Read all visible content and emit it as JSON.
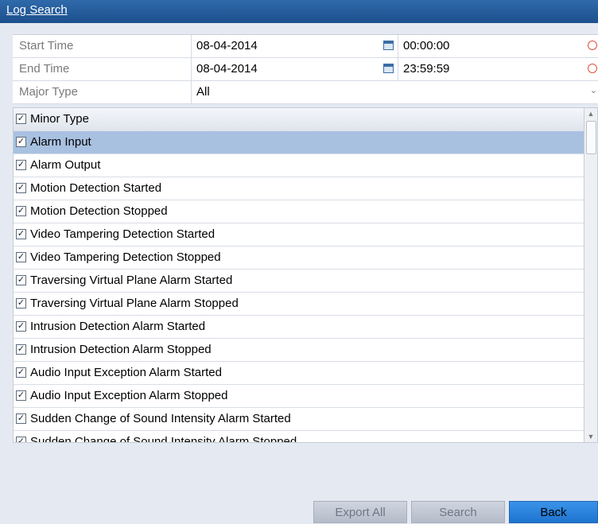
{
  "window": {
    "title": "Log Search"
  },
  "form": {
    "start_time": {
      "label": "Start Time",
      "date": "08-04-2014",
      "time": "00:00:00"
    },
    "end_time": {
      "label": "End Time",
      "date": "08-04-2014",
      "time": "23:59:59"
    },
    "major_type": {
      "label": "Major Type",
      "value": "All"
    }
  },
  "minor_type": {
    "header": "Minor Type",
    "header_checked": true,
    "items": [
      {
        "label": "Alarm Input",
        "checked": true,
        "selected": true
      },
      {
        "label": "Alarm Output",
        "checked": true
      },
      {
        "label": "Motion Detection Started",
        "checked": true
      },
      {
        "label": "Motion Detection Stopped",
        "checked": true
      },
      {
        "label": "Video Tampering Detection Started",
        "checked": true
      },
      {
        "label": "Video Tampering Detection Stopped",
        "checked": true
      },
      {
        "label": "Traversing Virtual Plane Alarm Started",
        "checked": true
      },
      {
        "label": "Traversing Virtual Plane Alarm Stopped",
        "checked": true
      },
      {
        "label": "Intrusion Detection Alarm Started",
        "checked": true
      },
      {
        "label": "Intrusion Detection Alarm Stopped",
        "checked": true
      },
      {
        "label": "Audio Input Exception Alarm Started",
        "checked": true
      },
      {
        "label": "Audio Input Exception Alarm Stopped",
        "checked": true
      },
      {
        "label": "Sudden Change of Sound Intensity Alarm Started",
        "checked": true
      },
      {
        "label": "Sudden Change of Sound Intensity Alarm Stopped",
        "checked": true
      }
    ]
  },
  "buttons": {
    "export_all": "Export All",
    "search": "Search",
    "back": "Back"
  },
  "icons": {
    "calendar": "calendar-icon",
    "clock": "clock-icon",
    "dropdown": "chevron-down-icon",
    "check": "✓"
  },
  "colors": {
    "title_bar": "#1c4f8c",
    "selected_row": "#a9c1e1",
    "primary_button": "#1e73cf"
  }
}
